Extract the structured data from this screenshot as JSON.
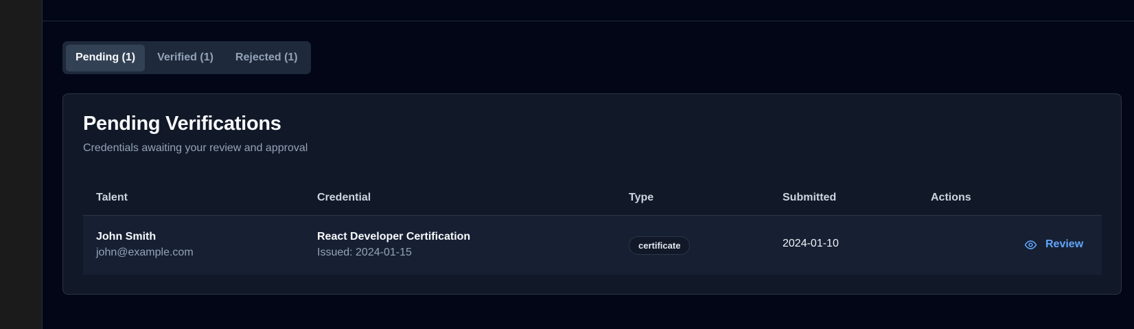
{
  "tabs": [
    {
      "label": "Pending (1)"
    },
    {
      "label": "Verified (1)"
    },
    {
      "label": "Rejected (1)"
    }
  ],
  "card": {
    "title": "Pending Verifications",
    "subtitle": "Credentials awaiting your review and approval"
  },
  "table": {
    "headers": [
      "Talent",
      "Credential",
      "Type",
      "Submitted",
      "Actions"
    ],
    "rows": [
      {
        "talent_name": "John Smith",
        "talent_email": "john@example.com",
        "credential_title": "React Developer Certification",
        "credential_issued": "Issued: 2024-01-15",
        "type": "certificate",
        "submitted": "2024-01-10",
        "action_label": "Review",
        "action_icon": "eye-icon"
      }
    ]
  },
  "colors": {
    "background": "#020617",
    "card": "#111827",
    "accent": "#60a5fa",
    "active_tab": "#334155"
  }
}
